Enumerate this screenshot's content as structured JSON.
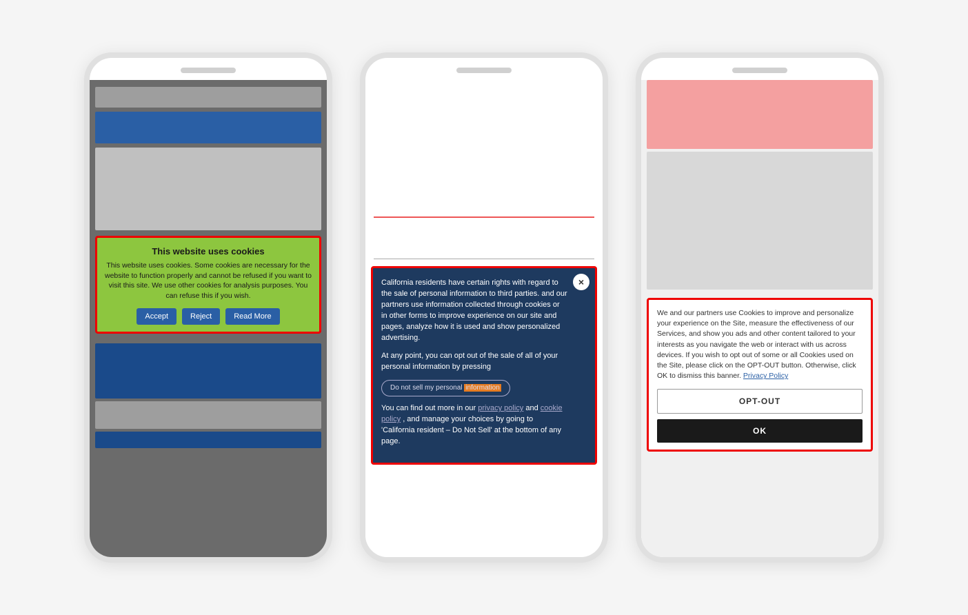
{
  "phones": [
    {
      "id": "phone1",
      "cookie_banner": {
        "title": "This website uses cookies",
        "text": "This website uses cookies. Some cookies are necessary for the website to function properly and cannot be refused if you want to visit this site. We use other cookies for analysis purposes. You can refuse this if you wish.",
        "buttons": [
          "Accept",
          "Reject",
          "Read More"
        ]
      }
    },
    {
      "id": "phone2",
      "cookie_banner": {
        "text1": "California residents have certain rights with regard to the sale of personal information to third parties.",
        "text2": "and our partners use information collected through cookies or in other forms to improve experience on our site and pages, analyze how it is used and show personalized advertising.",
        "text3": "At any point, you can opt out of the sale of all of your personal information by pressing",
        "donot_btn": "Do not sell my personal information",
        "text4": "You can find out more in our",
        "link1": "privacy policy",
        "text5": "and",
        "link2": "cookie policy",
        "text6": ", and manage your choices by going to 'California resident – Do Not Sell' at the bottom of any page.",
        "close_icon": "×"
      }
    },
    {
      "id": "phone3",
      "cookie_banner": {
        "text": "We and our partners use Cookies to improve and personalize your experience on the Site, measure the effectiveness of our Services, and show you ads and other content tailored to your interests as you navigate the web or interact with us across devices. If you wish to opt out of some or all Cookies used on the Site, please click on the OPT-OUT button. Otherwise, click OK to dismiss this banner.",
        "privacy_link": "Privacy Policy",
        "opt_out_btn": "OPT-OUT",
        "ok_btn": "OK"
      }
    }
  ]
}
